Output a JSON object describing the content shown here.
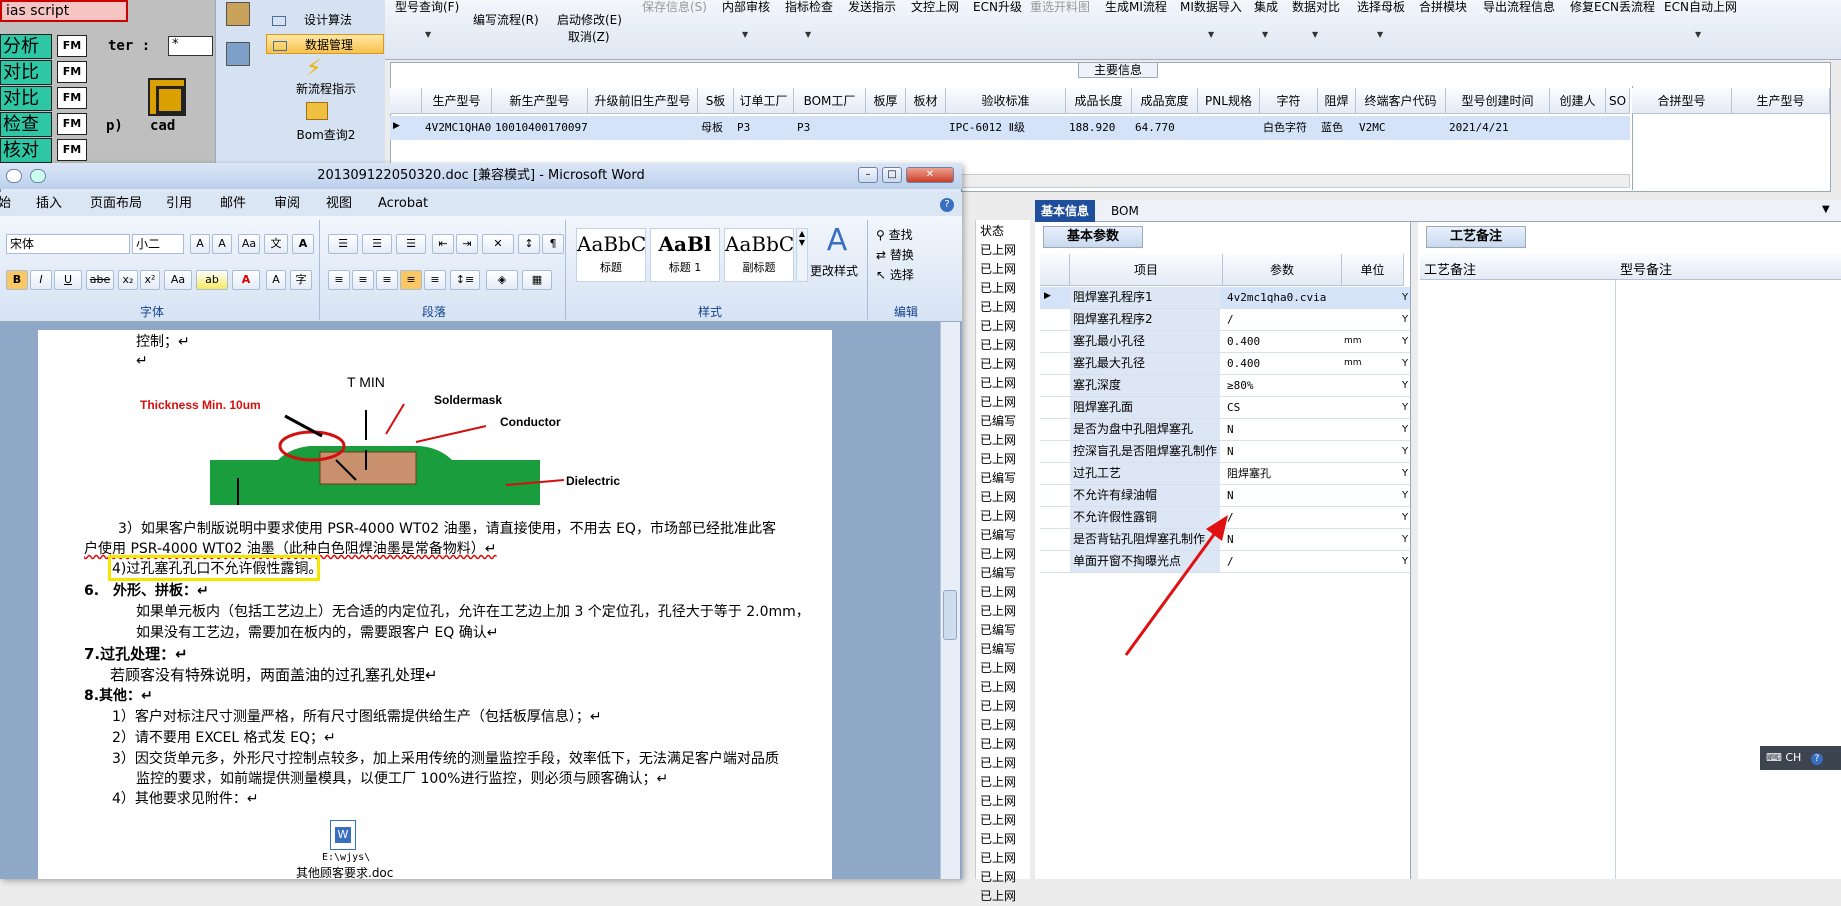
{
  "left_app": {
    "top_label": "ias script",
    "rows": [
      "分析",
      "对比",
      "对比",
      "检查",
      "核对"
    ],
    "fm_labels": [
      "FM",
      "FM",
      "FM",
      "FM",
      "FM"
    ],
    "filter_label": "ter :",
    "filter_value": "*",
    "p_label": "p)",
    "cad_label": "cad"
  },
  "nav": {
    "items": [
      "设计算法",
      "数据管理"
    ],
    "new_flow": "新流程指示",
    "bom_query": "Bom查询2"
  },
  "toolbar": {
    "items": [
      "型号查询(F)",
      "编写流程(R)",
      "启动修改(E)",
      "保存信息(S)",
      "内部审核",
      "指标检查",
      "发送指示",
      "文控上网",
      "ECN升级",
      "重选开料图",
      "生成MI流程",
      "MI数据导入",
      "集成",
      "数据对比",
      "选择母板",
      "合拼模块",
      "导出流程信息",
      "修复ECN丢流程",
      "ECN自动上网"
    ],
    "cancel": "取消(Z)"
  },
  "main_info": {
    "title": "主要信息",
    "columns": [
      "生产型号",
      "新生产型号",
      "升级前旧生产型号",
      "S板",
      "订单工厂",
      "BOM工厂",
      "板厚",
      "板材",
      "验收标准",
      "成品长度",
      "成品宽度",
      "PNL规格",
      "字符",
      "阻焊",
      "终端客户代码",
      "型号创建时间",
      "创建人",
      "SO"
    ],
    "row": [
      "4V2MC1QHA0",
      "10010400170097",
      "",
      "母板",
      "P3",
      "P3",
      "",
      "",
      "IPC-6012 Ⅱ级",
      "188.920",
      "64.770",
      "",
      "白色字符",
      "蓝色",
      "V2MC",
      "2021/4/21",
      "",
      ""
    ],
    "merge_columns": [
      "合拼型号",
      "生产型号"
    ]
  },
  "tabs": {
    "basic": "基本信息",
    "bom": "BOM",
    "basic_params": "基本参数",
    "process_note": "工艺备注"
  },
  "params": {
    "headers": [
      "项目",
      "参数",
      "单位"
    ],
    "rows": [
      {
        "k": "阻焊塞孔程序1",
        "v": "4v2mc1qha0.cvia",
        "u": "",
        "y": "Y"
      },
      {
        "k": "阻焊塞孔程序2",
        "v": "/",
        "u": "",
        "y": "Y"
      },
      {
        "k": "塞孔最小孔径",
        "v": "0.400",
        "u": "mm",
        "y": "Y"
      },
      {
        "k": "塞孔最大孔径",
        "v": "0.400",
        "u": "mm",
        "y": "Y"
      },
      {
        "k": "塞孔深度",
        "v": "≥80%",
        "u": "",
        "y": "Y"
      },
      {
        "k": "阻焊塞孔面",
        "v": "CS",
        "u": "",
        "y": "Y"
      },
      {
        "k": "是否为盘中孔阻焊塞孔",
        "v": "N",
        "u": "",
        "y": "Y"
      },
      {
        "k": "控深盲孔是否阻焊塞孔制作",
        "v": "N",
        "u": "",
        "y": "Y"
      },
      {
        "k": "过孔工艺",
        "v": "阻焊塞孔",
        "u": "",
        "y": "Y"
      },
      {
        "k": "不允许有绿油帽",
        "v": "N",
        "u": "",
        "y": "Y"
      },
      {
        "k": "不允许假性露铜",
        "v": "/",
        "u": "",
        "y": "Y"
      },
      {
        "k": "是否背钻孔阻焊塞孔制作",
        "v": "N",
        "u": "",
        "y": "Y"
      },
      {
        "k": "单面开窗不掏曝光点",
        "v": "/",
        "u": "",
        "y": "Y"
      }
    ]
  },
  "remarks": {
    "process_col": "工艺备注",
    "model_col": "型号备注"
  },
  "status": {
    "header": "状态",
    "items": [
      "已上网",
      "已上网",
      "已上网",
      "已上网",
      "已上网",
      "已上网",
      "已上网",
      "已上网",
      "已上网",
      "已编写",
      "已上网",
      "已上网",
      "已编写",
      "已上网",
      "已上网",
      "已编写",
      "已上网",
      "已编写",
      "已上网",
      "已上网",
      "已编写",
      "已编写",
      "已上网",
      "已上网",
      "已上网",
      "已上网",
      "已上网",
      "已上网",
      "已上网",
      "已上网",
      "已上网",
      "已上网",
      "已上网",
      "已上网",
      "已上网"
    ]
  },
  "word": {
    "title": "201309122050320.doc [兼容模式] - Microsoft Word",
    "tabs": [
      "始",
      "插入",
      "页面布局",
      "引用",
      "邮件",
      "审阅",
      "视图",
      "Acrobat"
    ],
    "font_name": "宋体",
    "font_size": "小二",
    "styles": [
      {
        "preview": "AaBbC",
        "name": "标题"
      },
      {
        "preview": "AaBl",
        "name": "标题 1"
      },
      {
        "preview": "AaBbC",
        "name": "副标题"
      }
    ],
    "change_style": "更改样式",
    "find": "查找",
    "replace": "替换",
    "select": "选择",
    "groups": [
      "字体",
      "段落",
      "样式",
      "编辑"
    ],
    "lines": [
      "控制；↵",
      "↵",
      "3）如果客户制版说明中要求使用 PSR-4000 WT02 油墨，请直接使用，不用去 EQ，市场部已经批准此客",
      "户使用 PSR-4000 WT02 油墨（此种白色阻焊油墨是常备物料）↵",
      "4)过孔塞孔孔口不允许假性露铜。",
      "6.　外形、拼板：↵",
      "如果单元板内（包括工艺边上）无合适的内定位孔，允许在工艺边上加 3 个定位孔，孔径大于等于 2.0mm，",
      "如果没有工艺边，需要加在板内的，需要跟客户 EQ 确认↵",
      "7.过孔处理：↵",
      "若顾客没有特殊说明，两面盖油的过孔塞孔处理↵",
      "8.其他：↵",
      "1）客户对标注尺寸测量严格，所有尺寸图纸需提供给生产（包括板厚信息）；↵",
      "2）请不要用 EXCEL 格式发 EQ；↵",
      "3）因交货单元多，外形尺寸控制点较多，加上采用传统的测量监控手段，效率低下，无法满足客户端对品质",
      "监控的要求，如前端提供测量模具，以便工厂 100%进行监控，则必须与顾客确认；↵",
      "4）其他要求见附件：↵"
    ],
    "attachment_path": "E:\\wjys\\",
    "attachment_name": "其他顾客要求.doc",
    "diagram": {
      "title": "T MIN",
      "thickness": "Thickness Min. 10um",
      "soldermask": "Soldermask",
      "conductor": "Conductor",
      "dielectric": "Dielectric"
    }
  },
  "ime": {
    "label": "CH"
  },
  "colors": {
    "accent": "#1f4e9c",
    "highlight": "#f5e600",
    "arrow": "#e01010"
  }
}
